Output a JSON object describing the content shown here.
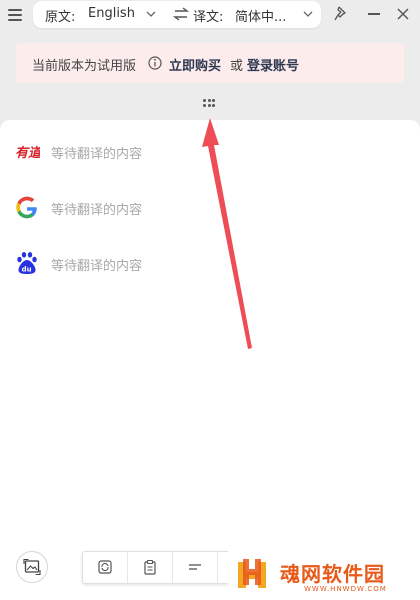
{
  "header": {
    "source_label": "原文:",
    "source_lang": "English",
    "target_label": "译文:",
    "target_lang": "简体中..."
  },
  "notice": {
    "text": "当前版本为试用版",
    "buy_label": "立即购买",
    "or_text": "或",
    "login_label": "登录账号"
  },
  "results": [
    {
      "engine_icon": "youdao-logo-icon",
      "placeholder": "等待翻译的内容"
    },
    {
      "engine_icon": "google-logo-icon",
      "placeholder": "等待翻译的内容"
    },
    {
      "engine_icon": "baidu-logo-icon",
      "placeholder": "等待翻译的内容"
    }
  ],
  "watermark": {
    "name": "魂网软件园",
    "url": "WWW.HNWDW.COM"
  },
  "colors": {
    "notice_bg": "#fdecec",
    "accent_arrow": "#ee4d55",
    "watermark": "#e8591a",
    "youdao": "#d8232a",
    "baidu": "#2932e1"
  }
}
